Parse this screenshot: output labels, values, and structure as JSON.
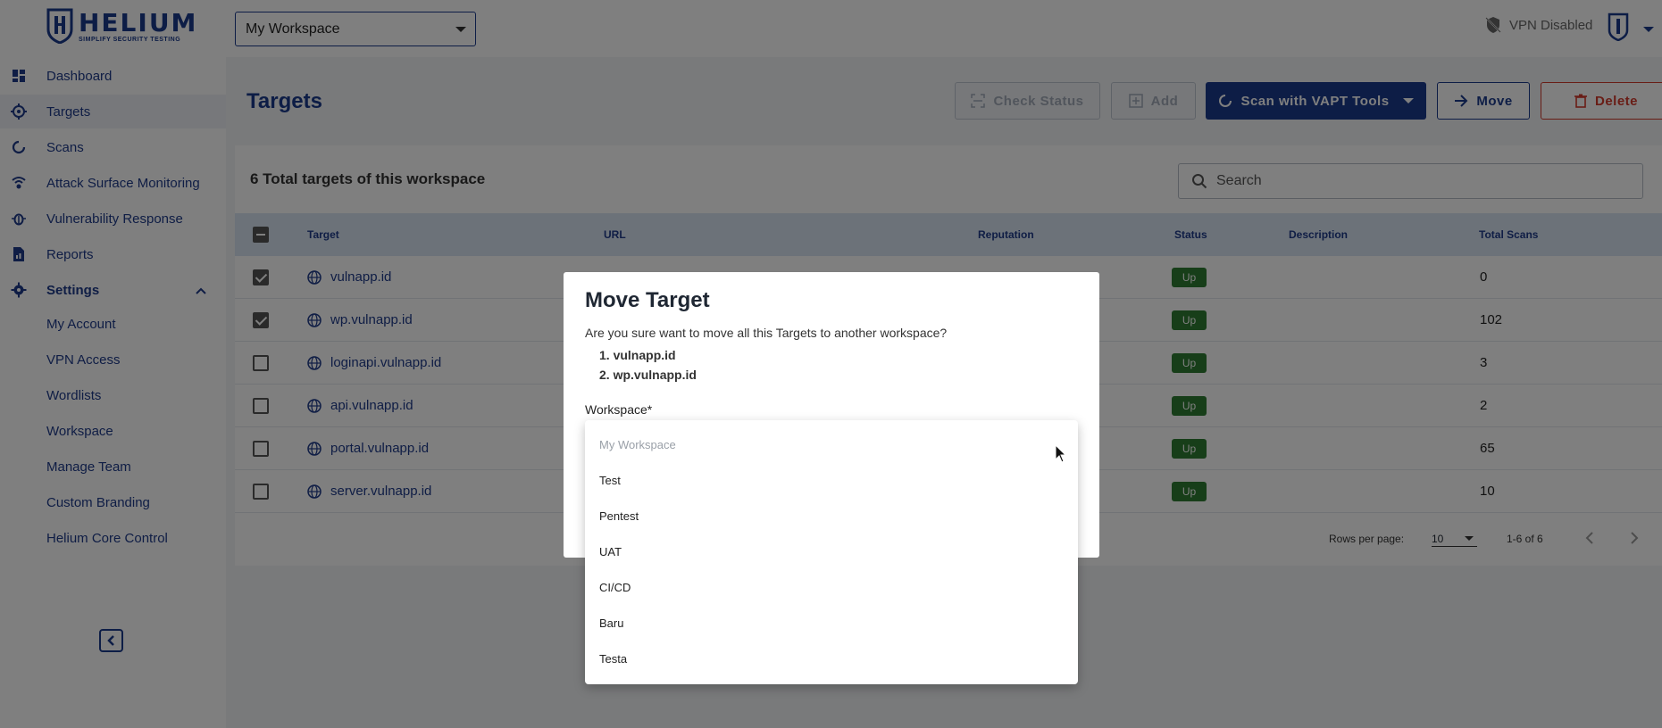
{
  "brand": {
    "name": "HELIUM",
    "tagline": "SIMPLIFY SECURITY TESTING",
    "primary": "#1b3a8c",
    "danger": "#d33a2c",
    "success": "#2e7d32"
  },
  "header": {
    "workspace": "My Workspace",
    "vpn_status": "VPN Disabled"
  },
  "sidebar": {
    "items": [
      {
        "label": "Dashboard",
        "icon": "dashboard-icon"
      },
      {
        "label": "Targets",
        "icon": "target-icon"
      },
      {
        "label": "Scans",
        "icon": "scan-icon"
      },
      {
        "label": "Attack Surface Monitoring",
        "icon": "radar-icon"
      },
      {
        "label": "Vulnerability Response",
        "icon": "bug-icon"
      },
      {
        "label": "Reports",
        "icon": "report-icon"
      },
      {
        "label": "Settings",
        "icon": "gear-icon"
      }
    ],
    "settings_children": [
      "My Account",
      "VPN Access",
      "Wordlists",
      "Workspace",
      "Manage Team",
      "Custom Branding",
      "Helium Core Control"
    ]
  },
  "page": {
    "title": "Targets",
    "buttons": {
      "check_status": "Check Status",
      "add": "Add",
      "scan": "Scan with VAPT Tools",
      "move": "Move",
      "delete": "Delete"
    },
    "summary": "6 Total targets of this workspace",
    "search_placeholder": "Search"
  },
  "table": {
    "columns": [
      "Target",
      "URL",
      "Reputation",
      "Status",
      "Description",
      "Total Scans"
    ],
    "rows": [
      {
        "target": "vulnapp.id",
        "status": "Up",
        "scans": "0",
        "checked": true
      },
      {
        "target": "wp.vulnapp.id",
        "status": "Up",
        "scans": "102",
        "checked": true
      },
      {
        "target": "loginapi.vulnapp.id",
        "status": "Up",
        "scans": "3",
        "checked": false
      },
      {
        "target": "api.vulnapp.id",
        "status": "Up",
        "scans": "2",
        "checked": false
      },
      {
        "target": "portal.vulnapp.id",
        "status": "Up",
        "scans": "65",
        "checked": false
      },
      {
        "target": "server.vulnapp.id",
        "status": "Up",
        "scans": "10",
        "checked": false
      }
    ],
    "rows_per_page_label": "Rows per page:",
    "rows_per_page": "10",
    "range": "1-6 of 6"
  },
  "modal": {
    "title": "Move Target",
    "question": "Are you sure want to move all this Targets to another workspace?",
    "list": [
      "vulnapp.id",
      "wp.vulnapp.id"
    ],
    "workspace_label": "Workspace*"
  },
  "dropdown": {
    "options": [
      "My Workspace",
      "Test",
      "Pentest",
      "UAT",
      "CI/CD",
      "Baru",
      "Testa"
    ]
  }
}
